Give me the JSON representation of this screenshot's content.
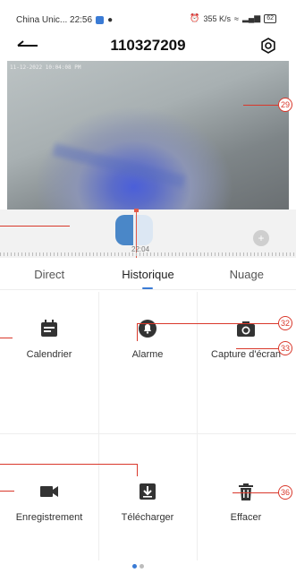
{
  "status_bar": {
    "carrier_time": "China Unic... 22:56",
    "speed": "355 K/s",
    "battery": "62"
  },
  "header": {
    "title": "110327209"
  },
  "video": {
    "timestamp": "11-12-2022 10:04:08 PM"
  },
  "timeline": {
    "time_label": "22:04"
  },
  "tabs": [
    {
      "label": "Direct",
      "active": false
    },
    {
      "label": "Historique",
      "active": true
    },
    {
      "label": "Nuage",
      "active": false
    }
  ],
  "actions": {
    "calendar": "Calendrier",
    "alarm": "Alarme",
    "screenshot": "Capture d'écran",
    "record": "Enregistrement",
    "download": "Télécharger",
    "delete": "Effacer"
  },
  "callouts": {
    "c29": "29",
    "c32": "32",
    "c33": "33",
    "c36": "36"
  },
  "colors": {
    "accent": "#3a7bd5",
    "annotation": "#d9382b"
  }
}
